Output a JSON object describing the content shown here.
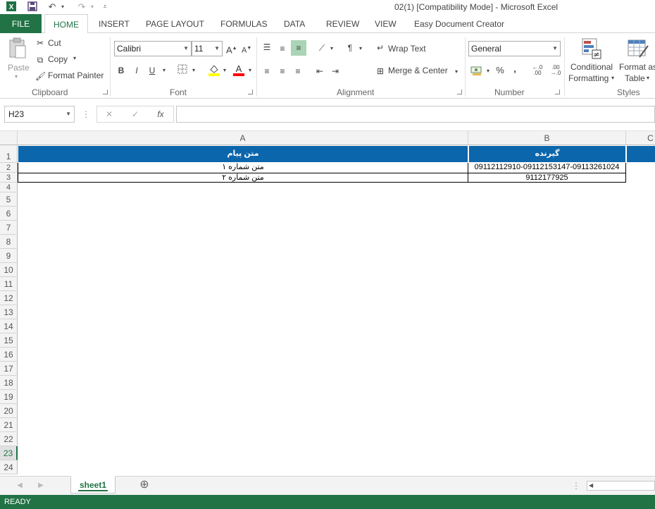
{
  "window": {
    "title": "02(1)  [Compatibility Mode] - Microsoft Excel"
  },
  "qat": {
    "save": "save-icon",
    "undo": "undo-icon",
    "redo": "redo-icon"
  },
  "tabs": [
    "FILE",
    "HOME",
    "INSERT",
    "PAGE LAYOUT",
    "FORMULAS",
    "DATA",
    "REVIEW",
    "VIEW",
    "Easy Document Creator"
  ],
  "ribbon": {
    "clipboard": {
      "paste": "Paste",
      "cut": "Cut",
      "copy": "Copy",
      "format_painter": "Format Painter",
      "label": "Clipboard"
    },
    "font": {
      "name": "Calibri",
      "size": "11",
      "bold": "B",
      "italic": "I",
      "underline": "U",
      "label": "Font",
      "fill_color": "#ffff00",
      "font_color": "#ff0000"
    },
    "alignment": {
      "wrap_text": "Wrap Text",
      "merge_center": "Merge & Center",
      "label": "Alignment"
    },
    "number": {
      "format": "General",
      "percent": "%",
      "comma": ",",
      "label": "Number"
    },
    "styles": {
      "conditional_line1": "Conditional",
      "conditional_line2": "Formatting",
      "format_as_line1": "Format as",
      "format_as_line2": "Table",
      "label": "Styles"
    }
  },
  "formula_bar": {
    "name_box": "H23",
    "fx": "fx",
    "value": ""
  },
  "grid": {
    "columns": [
      "A",
      "B",
      "C"
    ],
    "rows": [
      "1",
      "2",
      "3",
      "4",
      "5",
      "6",
      "7",
      "8",
      "9",
      "10",
      "11",
      "12",
      "13",
      "14",
      "15",
      "16",
      "17",
      "18",
      "19",
      "20",
      "21",
      "22",
      "23",
      "24"
    ],
    "header": {
      "a1": "متن پیام",
      "b1": "گیرنده"
    },
    "data": [
      {
        "a": "متن شماره ۱",
        "b": "09112112910-09112153147-09113261024"
      },
      {
        "a": "متن شماره ۲",
        "b": "9112177925"
      }
    ],
    "header_color": "#0b66ac"
  },
  "sheets": [
    "sheet1"
  ],
  "status": "READY",
  "accent": "#217346"
}
